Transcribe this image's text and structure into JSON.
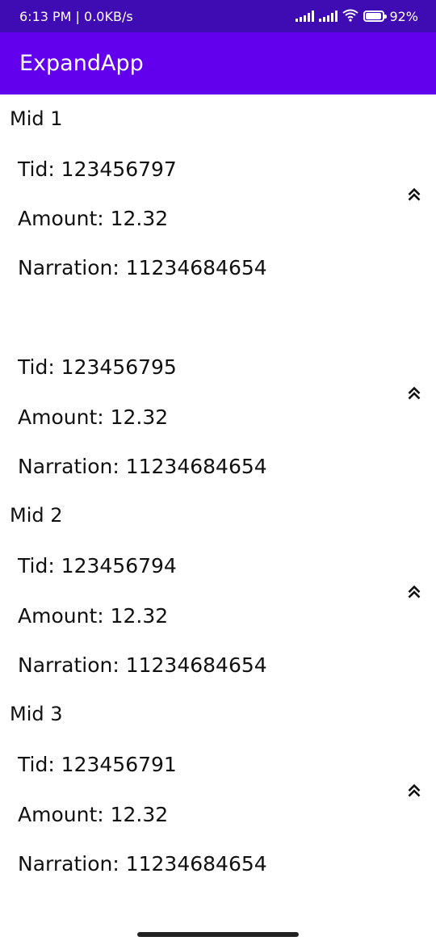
{
  "status": {
    "time_speed": "6:13 PM | 0.0KB/s",
    "battery_text": "92%",
    "battery_level": 0.92
  },
  "app": {
    "title": "ExpandApp"
  },
  "groups": [
    {
      "title": "Mid 1",
      "items": [
        {
          "tid": "Tid: 123456797",
          "amount": "Amount: 12.32",
          "narration": "Narration: 11234684654"
        },
        {
          "tid": "Tid: 123456795",
          "amount": "Amount: 12.32",
          "narration": "Narration: 11234684654"
        }
      ]
    },
    {
      "title": "Mid 2",
      "items": [
        {
          "tid": "Tid: 123456794",
          "amount": "Amount: 12.32",
          "narration": "Narration: 11234684654"
        }
      ]
    },
    {
      "title": "Mid 3",
      "items": [
        {
          "tid": "Tid: 123456791",
          "amount": "Amount: 12.32",
          "narration": "Narration: 11234684654"
        }
      ]
    }
  ],
  "icons": {
    "expand": "chevron-double-up-icon",
    "wifi": "wifi-icon",
    "signal": "signal-icon",
    "battery": "battery-icon"
  }
}
